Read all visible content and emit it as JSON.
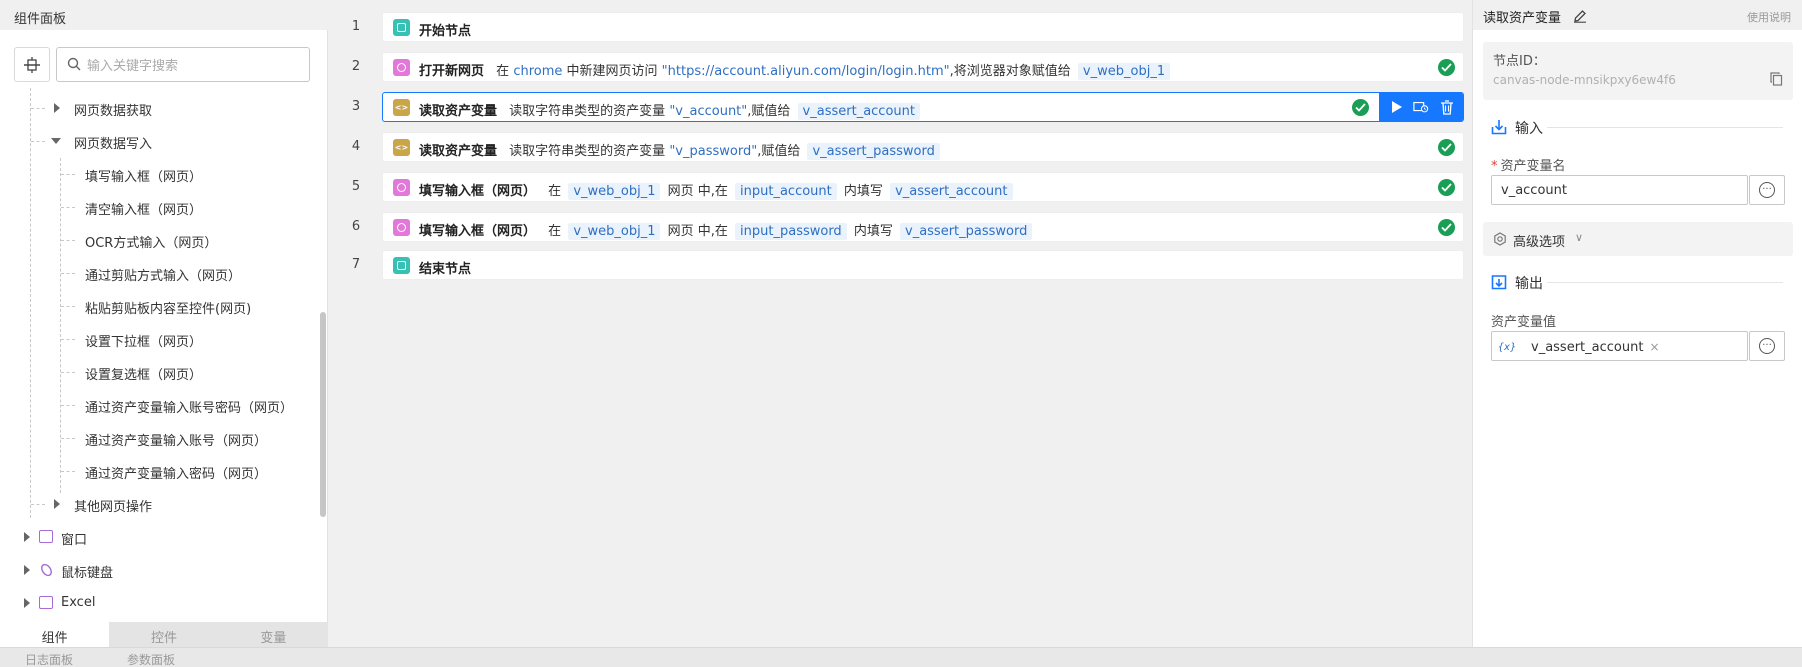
{
  "left_panel": {
    "title": "组件面板",
    "search_placeholder": "输入关键字搜索",
    "tree": [
      {
        "label": "网页数据获取"
      },
      {
        "label": "网页数据写入"
      },
      {
        "label": "填写输入框（网页）"
      },
      {
        "label": "清空输入框（网页）"
      },
      {
        "label": "OCR方式输入（网页）"
      },
      {
        "label": "通过剪贴方式输入（网页）"
      },
      {
        "label": "粘贴剪贴板内容至控件(网页)"
      },
      {
        "label": "设置下拉框（网页）"
      },
      {
        "label": "设置复选框（网页）"
      },
      {
        "label": "通过资产变量输入账号密码（网页）"
      },
      {
        "label": "通过资产变量输入账号（网页）"
      },
      {
        "label": "通过资产变量输入密码（网页）"
      },
      {
        "label": "其他网页操作"
      },
      {
        "label": "窗口"
      },
      {
        "label": "鼠标键盘"
      },
      {
        "label": "Excel"
      }
    ],
    "tabs": [
      "组件",
      "控件",
      "变量"
    ]
  },
  "status_bar": {
    "log_panel": "日志面板",
    "param_panel": "参数面板"
  },
  "flow": {
    "rows": [
      {
        "num": "1",
        "title": "开始节点"
      },
      {
        "num": "2",
        "title": "打开新网页",
        "p1": "在",
        "v1": "chrome",
        "p2": "中新建网页访问",
        "v2": "\"https://account.aliyun.com/login/login.htm\"",
        "p3": ",将浏览器对象赋值给",
        "v3": "v_web_obj_1"
      },
      {
        "num": "3",
        "title": "读取资产变量",
        "p1": "读取字符串类型的资产变量",
        "v1": "\"v_account\"",
        "p2": ",赋值给",
        "v2": "v_assert_account"
      },
      {
        "num": "4",
        "title": "读取资产变量",
        "p1": "读取字符串类型的资产变量",
        "v1": "\"v_password\"",
        "p2": ",赋值给",
        "v2": "v_assert_password"
      },
      {
        "num": "5",
        "title": "填写输入框（网页）",
        "p1": "在",
        "v1": "v_web_obj_1",
        "p2": "网页 中,在",
        "v2": "input_account",
        "p3": "内填写",
        "v3": "v_assert_account"
      },
      {
        "num": "6",
        "title": "填写输入框（网页）",
        "p1": "在",
        "v1": "v_web_obj_1",
        "p2": "网页 中,在",
        "v2": "input_password",
        "p3": "内填写",
        "v3": "v_assert_password"
      },
      {
        "num": "7",
        "title": "结束节点"
      }
    ]
  },
  "right_panel": {
    "title": "读取资产变量",
    "help": "使用说明",
    "node_id_label": "节点ID：",
    "node_id_value": "canvas-node-mnsikpxy6ew4f6",
    "input_section": "输入",
    "asset_name_label": "资产变量名",
    "asset_name_value": "v_account",
    "advanced": "高级选项",
    "output_section": "输出",
    "asset_value_label": "资产变量值",
    "asset_value_chip_icon": "{x}",
    "asset_value_chip": "v_assert_account"
  },
  "colors": {
    "accent": "#1677ff",
    "success": "#1a9d55",
    "var_text": "#2e6fc4",
    "start_icon": "#37c0b4",
    "web_icon": "#e278d8",
    "asset_icon": "#c9a64a"
  }
}
